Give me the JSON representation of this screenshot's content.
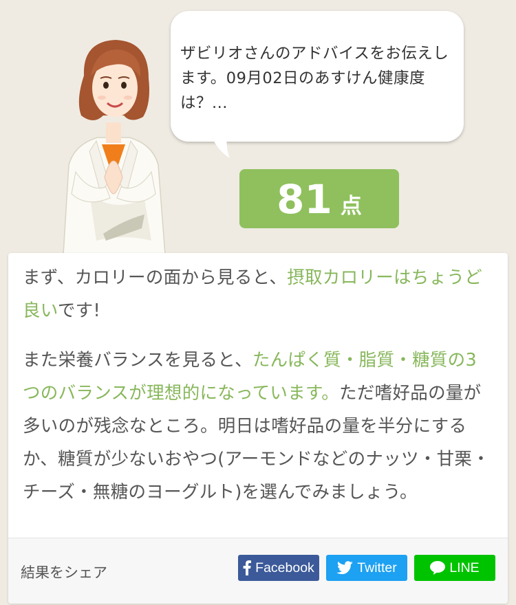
{
  "speech": {
    "text": "ザビリオさんのアドバイスをお伝えします。09月02日のあすけん健康度は？..."
  },
  "score": {
    "value": "81",
    "unit": "点"
  },
  "advice": {
    "p1_intro": "まず、カロリーの面から見ると、",
    "p1_highlight": "摂取カロリーはちょうど良い",
    "p1_end": "です!",
    "p2_intro": "また栄養バランスを見ると、",
    "p2_highlight": "たんぱく質・脂質・糖質の3つのバランスが理想的になっています。",
    "p2_end": "ただ嗜好品の量が多いのが残念なところ。明日は嗜好品の量を半分にするか、糖質が少ないおやつ(アーモンドなどのナッツ・甘栗・チーズ・無糖のヨーグルト)を選んでみましょう。"
  },
  "share": {
    "label": "結果をシェア",
    "facebook": "Facebook",
    "twitter": "Twitter",
    "line": "LINE"
  },
  "colors": {
    "background": "#efebe3",
    "accent_green": "#8fc05d",
    "highlight_text": "#87b75b",
    "facebook": "#3c5a99",
    "twitter": "#1da1f2",
    "line": "#00c300"
  },
  "icons": [
    "advisor-character",
    "facebook-icon",
    "twitter-bird-icon",
    "line-chat-icon"
  ]
}
